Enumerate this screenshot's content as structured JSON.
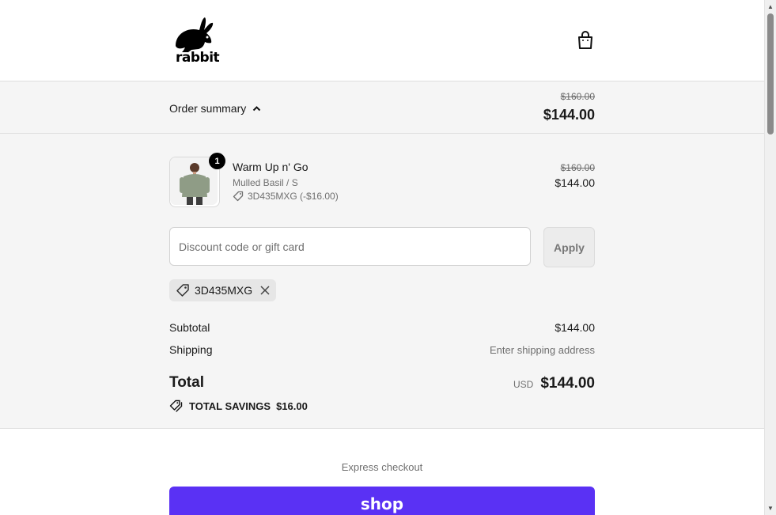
{
  "brand": {
    "name": "rabbit"
  },
  "header": {
    "cart_icon": "shopping-bag-icon"
  },
  "summary": {
    "toggle_label": "Order summary",
    "original_total": "$160.00",
    "total": "$144.00"
  },
  "line_item": {
    "quantity": "1",
    "name": "Warm Up n' Go",
    "variant": "Mulled Basil / S",
    "discount": "3D435MXG (-$16.00)",
    "original_price": "$160.00",
    "price": "$144.00"
  },
  "discount_form": {
    "placeholder": "Discount code or gift card",
    "value": "",
    "apply_label": "Apply",
    "applied_code": "3D435MXG"
  },
  "costs": {
    "subtotal_label": "Subtotal",
    "subtotal_value": "$144.00",
    "shipping_label": "Shipping",
    "shipping_value": "Enter shipping address",
    "total_label": "Total",
    "currency": "USD",
    "total_value": "$144.00",
    "savings_label": "TOTAL SAVINGS",
    "savings_value": "$16.00"
  },
  "express": {
    "title": "Express checkout",
    "shop_label": "shop"
  },
  "colors": {
    "shop_purple": "#5a31f4",
    "panel_bg": "#f5f5f5"
  }
}
